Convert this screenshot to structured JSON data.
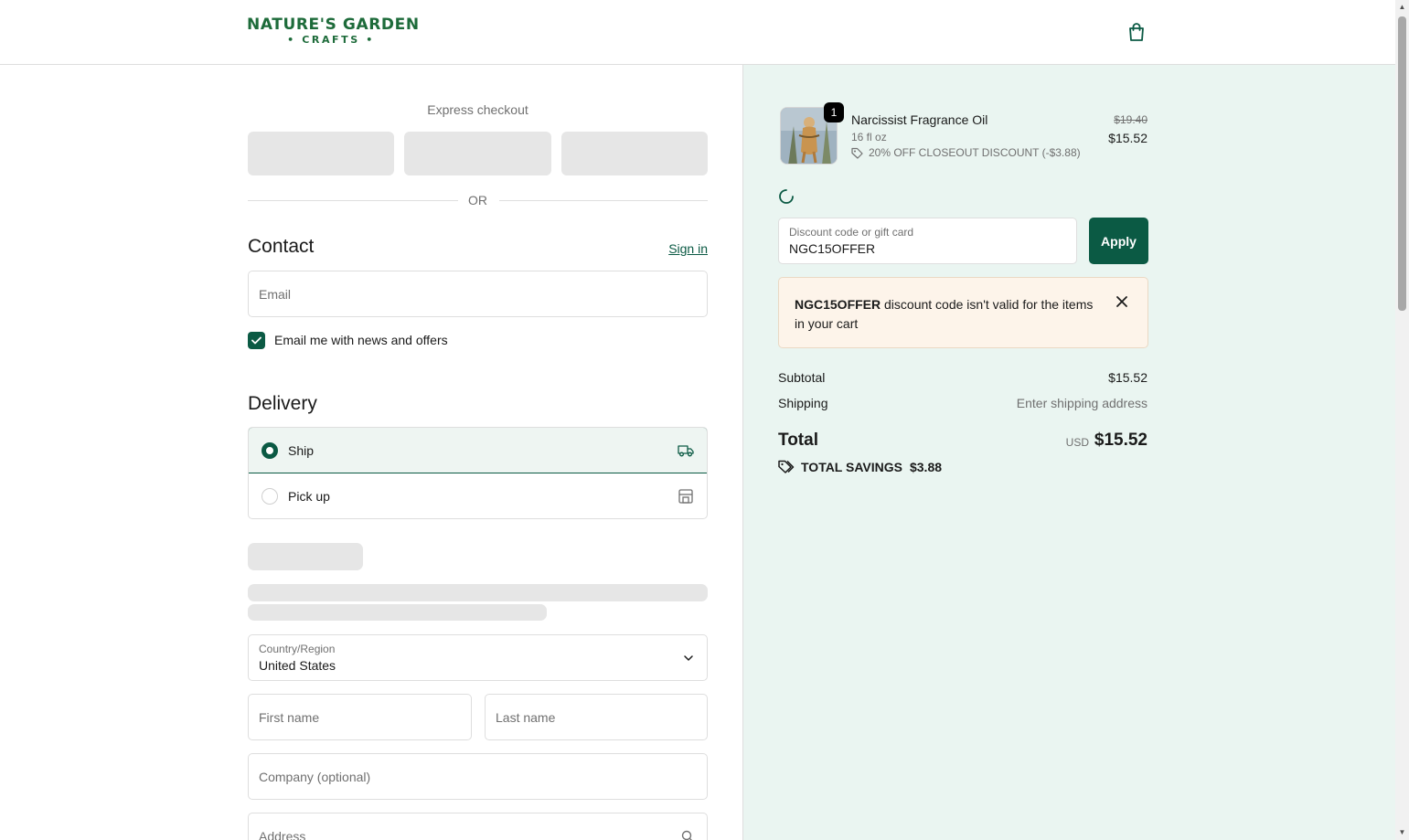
{
  "brand": {
    "logo_top": "NATURE'S GARDEN",
    "logo_bottom": "• CRAFTS •"
  },
  "express": {
    "title": "Express checkout",
    "or_label": "OR"
  },
  "contact": {
    "title": "Contact",
    "sign_in": "Sign in",
    "email_placeholder": "Email",
    "newsletter_label": "Email me with news and offers",
    "newsletter_checked": true
  },
  "delivery": {
    "title": "Delivery",
    "options": [
      {
        "label": "Ship",
        "icon": "truck-icon",
        "selected": true
      },
      {
        "label": "Pick up",
        "icon": "store-icon",
        "selected": false
      }
    ],
    "country_label": "Country/Region",
    "country_value": "United States",
    "first_name_placeholder": "First name",
    "last_name_placeholder": "Last name",
    "company_placeholder": "Company (optional)",
    "address_placeholder": "Address"
  },
  "cart": {
    "item": {
      "quantity": "1",
      "name": "Narcissist Fragrance Oil",
      "variant": "16 fl oz",
      "discount": "20% OFF CLOSEOUT DISCOUNT (-$3.88)",
      "original_price": "$19.40",
      "price": "$15.52"
    },
    "discount_field_label": "Discount code or gift card",
    "discount_field_value": "NGC15OFFER",
    "apply_label": "Apply",
    "alert_code": "NGC15OFFER",
    "alert_message": " discount code isn't valid for the items in your cart",
    "subtotal_label": "Subtotal",
    "subtotal_value": "$15.52",
    "shipping_label": "Shipping",
    "shipping_value": "Enter shipping address",
    "total_label": "Total",
    "total_currency": "USD",
    "total_value": "$15.52",
    "savings_label": "TOTAL SAVINGS",
    "savings_value": "$3.88"
  },
  "colors": {
    "accent": "#0b5a44",
    "logo": "#1d6b3a",
    "summary_bg": "#eaf5f1",
    "alert_bg": "#fdf4ea"
  }
}
